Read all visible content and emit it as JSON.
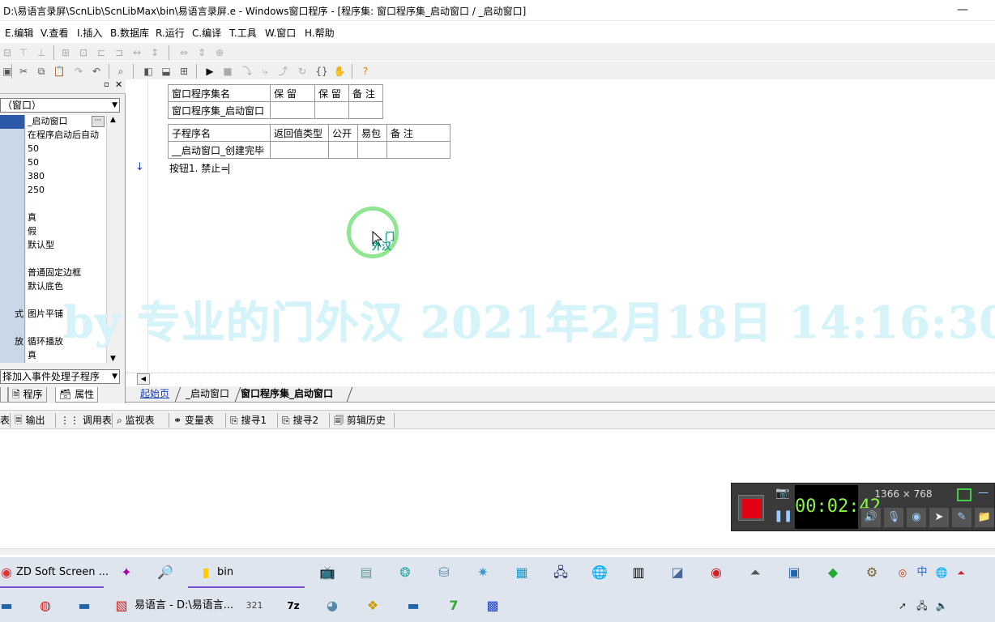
{
  "window": {
    "title": "D:\\易语言录屏\\ScnLib\\ScnLibMax\\bin\\易语言录屏.e - Windows窗口程序 - [程序集: 窗口程序集_启动窗口 / _启动窗口]",
    "minimize": "—",
    "maximize": "☐",
    "close": "✕"
  },
  "menu": [
    {
      "label": "E.编辑"
    },
    {
      "label": "V.查看"
    },
    {
      "label": "I.插入"
    },
    {
      "label": "B.数据库"
    },
    {
      "label": "R.运行"
    },
    {
      "label": "C.编译"
    },
    {
      "label": "T.工具"
    },
    {
      "label": "W.窗口"
    },
    {
      "label": "H.帮助"
    }
  ],
  "left_panel": {
    "combo_value": "（窗口）",
    "props": [
      {
        "value": "_启动窗口",
        "selected": true
      },
      {
        "value": "在程序启动后自动"
      },
      {
        "value": "50"
      },
      {
        "value": "50"
      },
      {
        "value": "380"
      },
      {
        "value": "250"
      },
      {
        "value": ""
      },
      {
        "value": "真"
      },
      {
        "value": "假"
      },
      {
        "value": "默认型"
      },
      {
        "value": ""
      },
      {
        "value": "普通固定边框"
      },
      {
        "value": "默认底色"
      },
      {
        "value": ""
      },
      {
        "name": "式",
        "value": "图片平铺"
      },
      {
        "value": ""
      },
      {
        "name": "放",
        "value": "循环播放"
      },
      {
        "value": "真"
      }
    ],
    "event_combo": "择加入事件处理子程序",
    "tabs": {
      "program": "程序",
      "properties": "属性"
    }
  },
  "editor": {
    "table1": {
      "headers": [
        "窗口程序集名",
        "保 留",
        "保 留",
        "备 注"
      ],
      "row": [
        "窗口程序集_启动窗口",
        "",
        "",
        ""
      ]
    },
    "table2": {
      "headers": [
        "子程序名",
        "返回值类型",
        "公开",
        "易包",
        "备 注"
      ],
      "row": [
        "__启动窗口_创建完毕",
        "",
        "",
        "",
        ""
      ]
    },
    "code_line": "按钮1. 禁止="
  },
  "cursor_logo": {
    "line1": "门",
    "line2": "外汉"
  },
  "watermark": "by 专业的门外汉 2021年2月18日 14:16:30",
  "doc_tabs": [
    {
      "label": "起始页"
    },
    {
      "label": "_启动窗口"
    },
    {
      "label": "窗口程序集_启动窗口"
    }
  ],
  "output_tabs": [
    {
      "label": "输出"
    },
    {
      "label": "调用表"
    },
    {
      "label": "监视表"
    },
    {
      "label": "变量表"
    },
    {
      "label": "搜寻1"
    },
    {
      "label": "搜寻2"
    },
    {
      "label": "剪辑历史"
    }
  ],
  "recorder": {
    "timer": "00:02:42",
    "resolution": "1366 × 768",
    "stop_color": "#e00012"
  },
  "taskbar": {
    "row1_apps": [
      {
        "label": "ZD Soft Screen ..."
      },
      {
        "label": "bin"
      }
    ],
    "row2_apps": [
      {
        "label": "易语言 - D:\\易语言..."
      }
    ],
    "tray_ime": "中"
  },
  "colors": {
    "selected_prop": "#2d5aa8",
    "link_tab": "#1a3fb0",
    "taskbar_bg": "#dee5ef"
  }
}
